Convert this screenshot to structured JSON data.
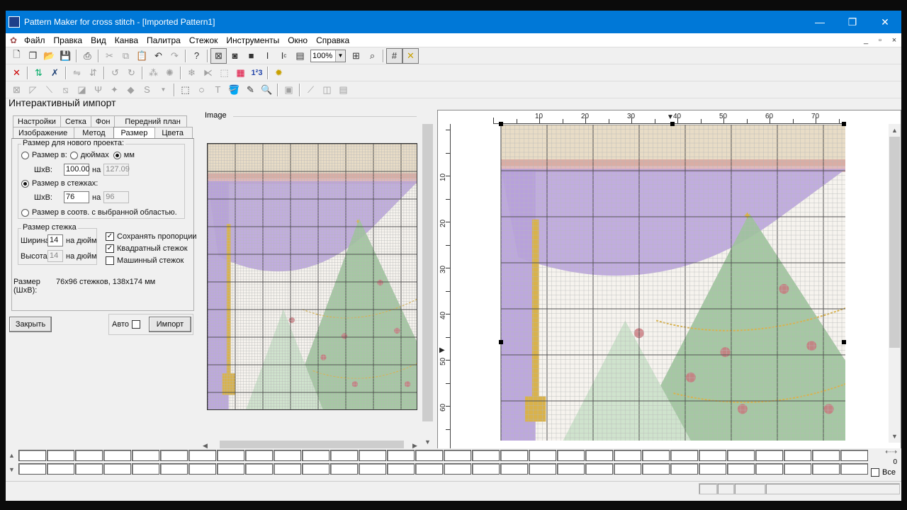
{
  "window": {
    "title": "Pattern Maker for cross stitch - [Imported Pattern1]",
    "minimize": "—",
    "restore": "❐",
    "close": "✕"
  },
  "menu": {
    "items": [
      "Файл",
      "Правка",
      "Вид",
      "Канва",
      "Палитра",
      "Стежок",
      "Инструменты",
      "Окно",
      "Справка"
    ],
    "mdi_minimize": "_",
    "mdi_restore": "▫",
    "mdi_close": "×"
  },
  "toolbar": {
    "zoom": "100%"
  },
  "import_panel": {
    "title": "Интерактивный импорт",
    "tabs_row1": [
      "Настройки",
      "Сетка",
      "Фон",
      "Передний план"
    ],
    "tabs_row2": [
      "Изображение",
      "Метод",
      "Размер",
      "Цвета"
    ],
    "selected_tab": "Размер",
    "new_project_group": "Размер для нового проекта:",
    "size_in_label": "Размер в:",
    "inches_label": "дюймах",
    "mm_label": "мм",
    "wxh_label": "ШxВ:",
    "width_mm": "100.00",
    "by_label": "на",
    "height_mm": "127.09",
    "size_in_stitches_label": "Размер в стежках:",
    "width_stitches": "76",
    "height_stitches": "96",
    "size_selection_label": "Размер в соотв. с выбранной областью.",
    "stitch_size_group": "Размер стежка",
    "width_label": "Ширина:",
    "width_value": "14",
    "per_inch_label": "на дюйм",
    "height_label": "Высота:",
    "height_value": "14",
    "keep_proportions": "Сохранять пропорции",
    "square_stitch": "Квадратный стежок",
    "machine_stitch": "Машинный стежок",
    "size_label": "Размер (ШxВ):",
    "size_value": "76x96 стежков,  138x174 мм",
    "close_button": "Закрыть",
    "auto_label": "Авто",
    "import_button": "Импорт"
  },
  "image_panel": {
    "label": "Image"
  },
  "ruler": {
    "top_labels": [
      "10",
      "20",
      "30",
      "40",
      "50",
      "60",
      "70"
    ],
    "left_labels": [
      "10",
      "20",
      "30",
      "40",
      "50",
      "60"
    ]
  },
  "palette": {
    "all_label": "Все",
    "counter": "0"
  },
  "colors": {
    "titlebar": "#0078d7",
    "curtain": "#b7a0dc",
    "tree": "#9cc39a",
    "gold": "#d9b24a",
    "ornament": "#c9747a"
  }
}
